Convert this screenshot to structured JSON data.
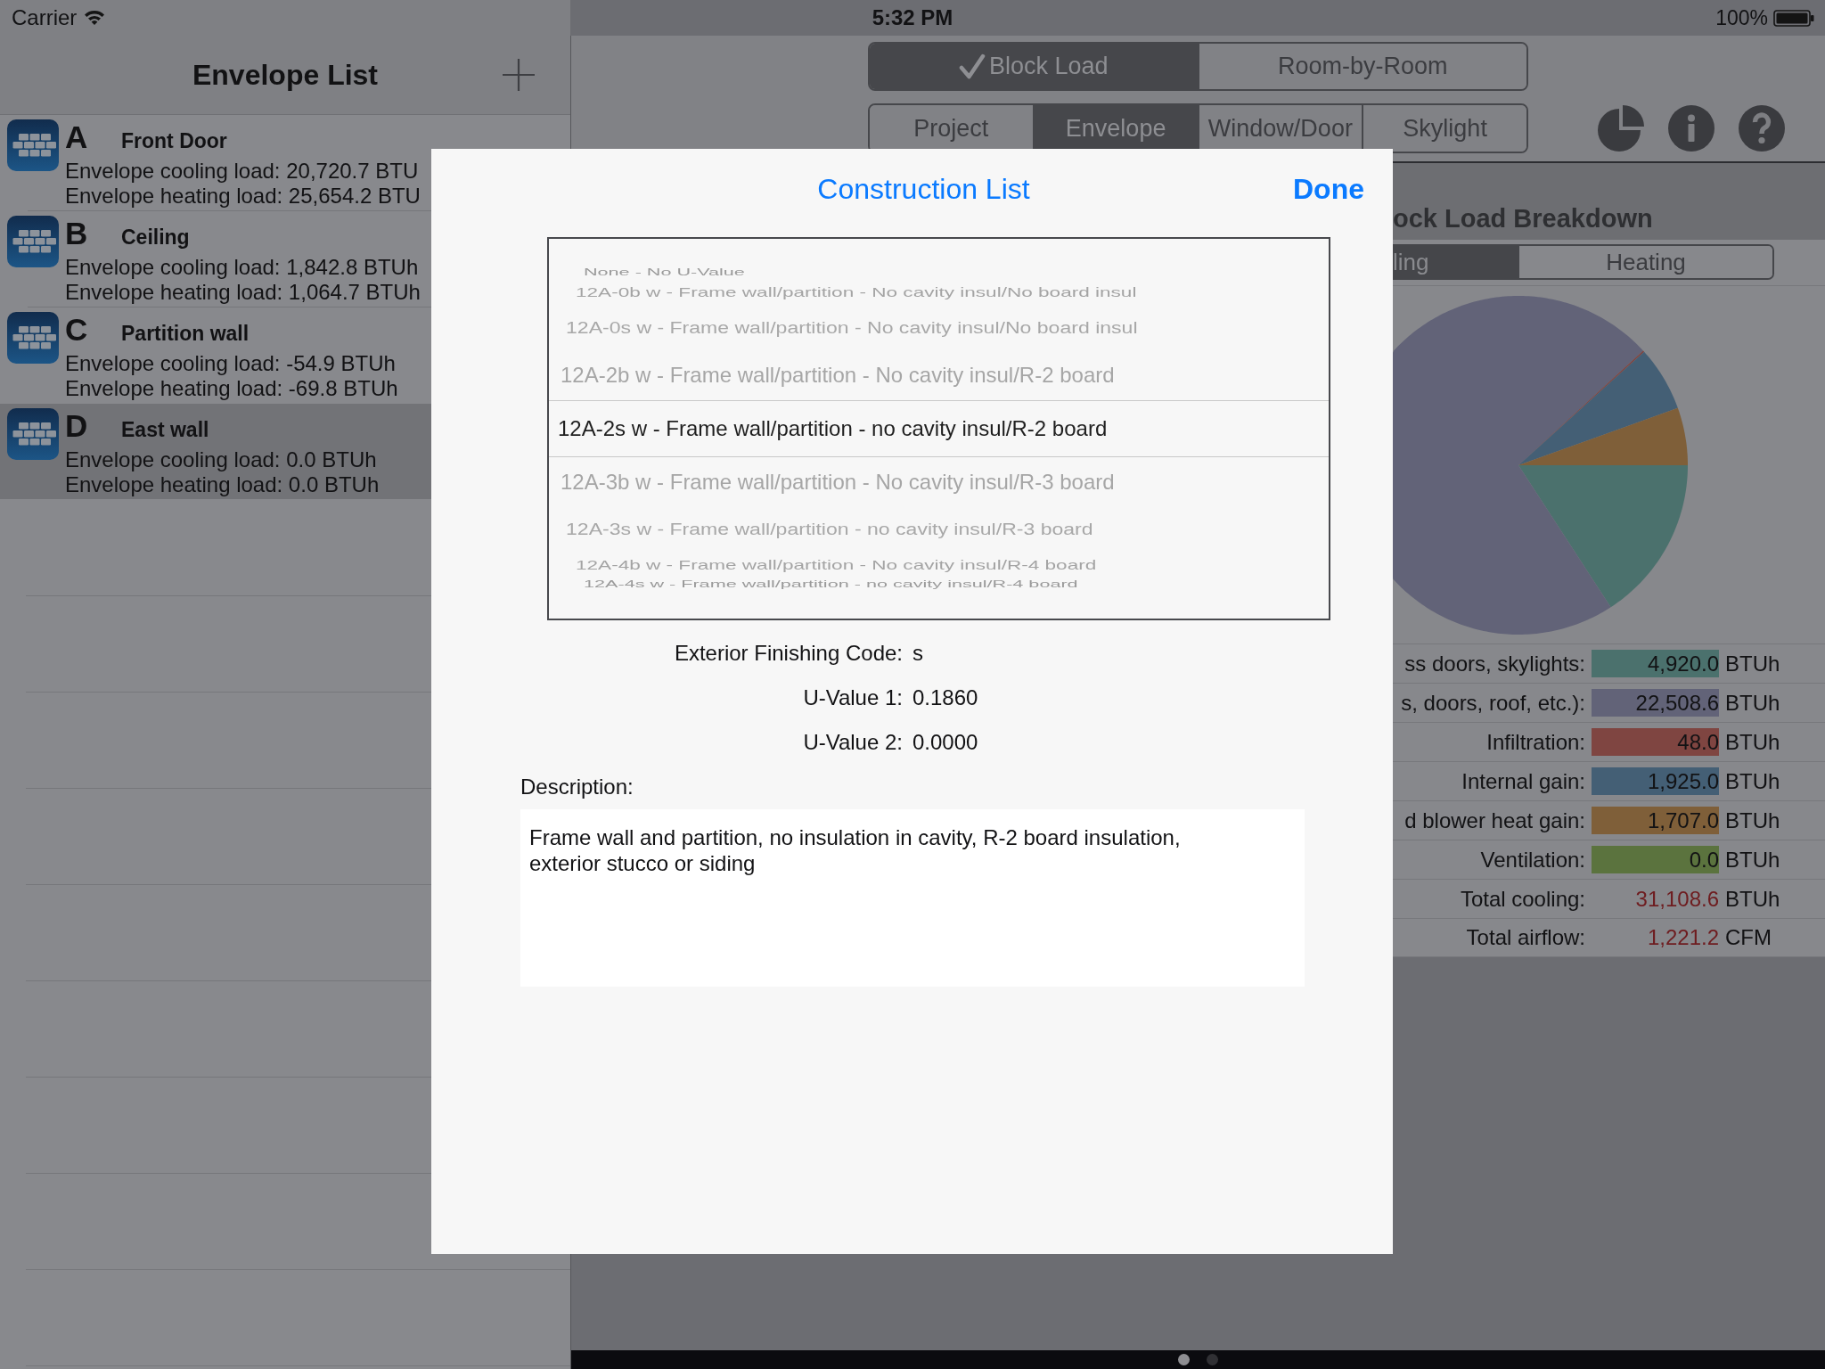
{
  "status_bar": {
    "carrier": "Carrier",
    "time": "5:32 PM",
    "battery": "100%"
  },
  "envelope_list": {
    "title": "Envelope List",
    "items": [
      {
        "letter": "A",
        "name": "Front Door",
        "cooling": "Envelope cooling load: 20,720.7 BTU",
        "heating": "Envelope heating load: 25,654.2 BTU",
        "selected": false
      },
      {
        "letter": "B",
        "name": "Ceiling",
        "cooling": "Envelope cooling load: 1,842.8 BTUh",
        "heating": "Envelope heating load: 1,064.7 BTUh",
        "selected": false
      },
      {
        "letter": "C",
        "name": "Partition wall",
        "cooling": "Envelope cooling load: -54.9 BTUh",
        "heating": "Envelope heating load: -69.8 BTUh",
        "selected": false
      },
      {
        "letter": "D",
        "name": "East wall",
        "cooling": "Envelope cooling load: 0.0 BTUh",
        "heating": "Envelope heating load: 0.0 BTUh",
        "selected": true
      }
    ]
  },
  "mode_tabs": [
    {
      "label": "Block Load",
      "selected": true
    },
    {
      "label": "Room-by-Room",
      "selected": false
    }
  ],
  "section_tabs": [
    {
      "label": "Project",
      "selected": false
    },
    {
      "label": "Envelope",
      "selected": true
    },
    {
      "label": "Window/Door",
      "selected": false
    },
    {
      "label": "Skylight",
      "selected": false
    }
  ],
  "breakdown": {
    "title": "ock Load Breakdown",
    "tabs": [
      {
        "label": "ling",
        "selected": true
      },
      {
        "label": "Heating",
        "selected": false
      }
    ],
    "chart_data": {
      "type": "pie",
      "values": [
        15.82,
        72.35,
        0.15,
        6.19,
        5.49,
        0.0
      ]
    },
    "rows": [
      {
        "label": "ss doors, skylights:",
        "value": "4,920.0",
        "unit": "BTUh",
        "color": "#4b716d"
      },
      {
        "label": "s, doors, roof, etc.):",
        "value": "22,508.6",
        "unit": "BTUh",
        "color": "#626378"
      },
      {
        "label": "Infiltration:",
        "value": "48.0",
        "unit": "BTUh",
        "color": "#7f4541"
      },
      {
        "label": "Internal gain:",
        "value": "1,925.0",
        "unit": "BTUh",
        "color": "#445f75"
      },
      {
        "label": "d blower heat gain:",
        "value": "1,707.0",
        "unit": "BTUh",
        "color": "#7f5f39"
      },
      {
        "label": "Ventilation:",
        "value": "0.0",
        "unit": "BTUh",
        "color": "#5b733e"
      }
    ],
    "totals": [
      {
        "label": "Total cooling:",
        "value": "31,108.6",
        "unit": "BTUh"
      },
      {
        "label": "Total airflow:",
        "value": "1,221.2",
        "unit": "CFM"
      }
    ]
  },
  "modal": {
    "title": "Construction List",
    "done": "Done",
    "options": [
      {
        "label": "None - No U-Value",
        "selected": false
      },
      {
        "label": "12A-0b w - Frame wall/partition - No cavity insul/No board insul",
        "selected": false
      },
      {
        "label": "12A-0s w - Frame wall/partition - No cavity insul/No board insul",
        "selected": false
      },
      {
        "label": "12A-2b w - Frame wall/partition - No cavity insul/R-2 board",
        "selected": false
      },
      {
        "label": "12A-2s w - Frame wall/partition - no cavity insul/R-2 board",
        "selected": true
      },
      {
        "label": "12A-3b w - Frame wall/partition - No cavity insul/R-3 board",
        "selected": false
      },
      {
        "label": "12A-3s w - Frame wall/partition - no cavity insul/R-3 board",
        "selected": false
      },
      {
        "label": "12A-4b w - Frame wall/partition - No cavity insul/R-4 board",
        "selected": false
      },
      {
        "label": "12A-4s w - Frame wall/partition - no cavity insul/R-4 board",
        "selected": false
      }
    ],
    "fields": [
      {
        "label": "Exterior Finishing Code:",
        "value": "s"
      },
      {
        "label": "U-Value 1:",
        "value": "0.1860"
      },
      {
        "label": "U-Value 2:",
        "value": "0.0000"
      }
    ],
    "description_label": "Description:",
    "description": "Frame wall and partition, no insulation in cavity, R-2 board insulation, exterior stucco or siding"
  },
  "page_indicator": [
    {
      "selected": true
    },
    {
      "selected": false
    }
  ]
}
